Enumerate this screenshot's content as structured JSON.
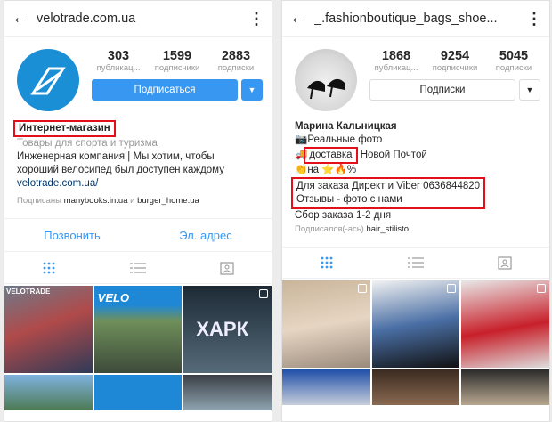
{
  "left": {
    "username": "velotrade.com.ua",
    "stats": [
      {
        "num": "303",
        "label": "публикац..."
      },
      {
        "num": "1599",
        "label": "подписчики"
      },
      {
        "num": "2883",
        "label": "подписки"
      }
    ],
    "follow_label": "Подписаться",
    "bio": {
      "name": "Интернет-магазин",
      "category": "Товары для спорта и туризма",
      "line1": "Инженерная компания | Мы хотим, чтобы",
      "line2": "хороший велосипед был доступен каждому",
      "link": "velotrade.com.ua/",
      "followed_prefix": "Подписаны",
      "followed_1": "manybooks.in.ua",
      "followed_and": "и",
      "followed_2": "burger_home.ua"
    },
    "action_call": "Позвонить",
    "action_email": "Эл. адрес",
    "tile_texts": [
      "VELOTRADE",
      "ХАРК",
      "VELO"
    ]
  },
  "right": {
    "username": "_.fashionboutique_bags_shoe...",
    "stats": [
      {
        "num": "1868",
        "label": "публикац..."
      },
      {
        "num": "9254",
        "label": "подписчики"
      },
      {
        "num": "5045",
        "label": "подписки"
      }
    ],
    "follow_label": "Подписки",
    "bio": {
      "name": "Марина Кальницкая",
      "line1": "Реальные фото",
      "line2a": "доставка",
      "line2b": " Новой Почтой",
      "line3": "на",
      "line3b": "%",
      "line4": "Для заказа Директ и Viber 0636844820",
      "line5": "Отзывы - фото с нами",
      "line6": "Сбор заказа 1-2 дня",
      "followed_prefix": "Подписался(-ась)",
      "followed_1": "hair_stilisto"
    }
  },
  "colors": {
    "accent": "#3897f0",
    "highlight": "#e3101b"
  }
}
